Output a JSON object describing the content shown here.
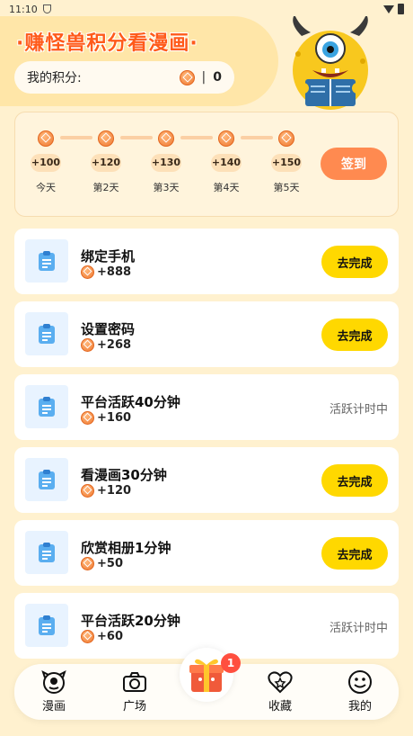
{
  "status_bar": {
    "time": "11:10"
  },
  "header": {
    "title": "·赚怪兽积分看漫画·",
    "points_label": "我的积分:",
    "points_separator": "|",
    "points_value": "0"
  },
  "checkin": {
    "days": [
      {
        "bonus": "+100",
        "label": "今天"
      },
      {
        "bonus": "+120",
        "label": "第2天"
      },
      {
        "bonus": "+130",
        "label": "第3天"
      },
      {
        "bonus": "+140",
        "label": "第4天"
      },
      {
        "bonus": "+150",
        "label": "第5天"
      }
    ],
    "button_label": "签到"
  },
  "tasks": [
    {
      "name": "绑定手机",
      "reward": "+888",
      "action": "去完成"
    },
    {
      "name": "设置密码",
      "reward": "+268",
      "action": "去完成"
    },
    {
      "name": "平台活跃40分钟",
      "reward": "+160",
      "status": "活跃计时中"
    },
    {
      "name": "看漫画30分钟",
      "reward": "+120",
      "action": "去完成"
    },
    {
      "name": "欣赏相册1分钟",
      "reward": "+50",
      "action": "去完成"
    },
    {
      "name": "平台活跃20分钟",
      "reward": "+60",
      "status": "活跃计时中"
    }
  ],
  "tabbar": {
    "items": [
      {
        "label": "漫画",
        "icon": "monster-face-icon"
      },
      {
        "label": "广场",
        "icon": "camera-icon"
      },
      {
        "label": "收藏",
        "icon": "heart-star-icon"
      },
      {
        "label": "我的",
        "icon": "smiley-icon"
      }
    ],
    "center_badge": "1",
    "center_icon": "gift-box-icon"
  },
  "colors": {
    "accent_orange": "#ff8a50",
    "title_orange": "#ff5a1a",
    "button_yellow": "#ffd800",
    "page_bg": "#fff1cf"
  }
}
